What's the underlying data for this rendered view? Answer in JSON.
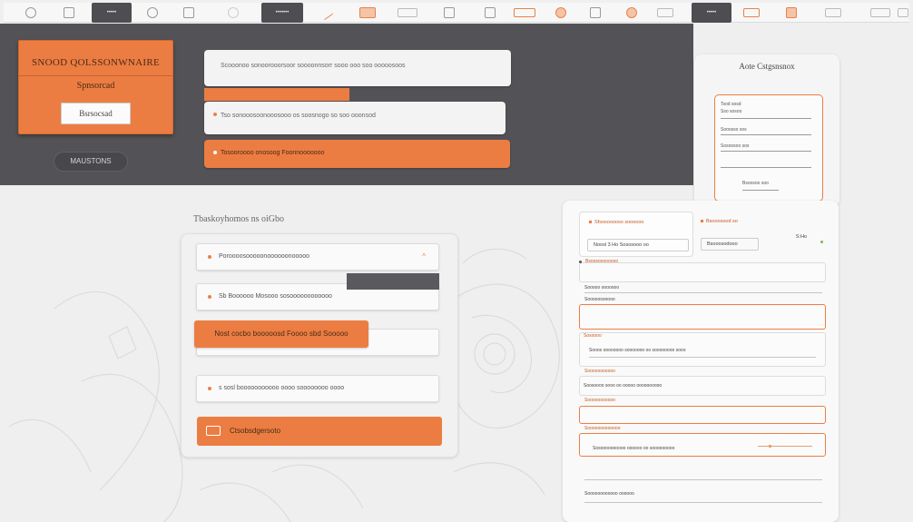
{
  "toolbar": {
    "tab_active_1": "•••••",
    "tab_active_2": "•••••••",
    "tab_active_3": "•••••"
  },
  "survey_card": {
    "title": "SNOOD QOLSSONWNAIRE",
    "subtitle": "Spnsorcad",
    "button_label": "Bsrsocsad"
  },
  "dark_pill": "MAUSTONS",
  "bars": [
    "Scooonoo sonoorooorsoor soooonnsorr sooo ooo soo ooooosoos",
    "Tso sonooosoonooosooo os soosnogo so soo ooonsod",
    "Tosooroooo onosoog Foonnooooooo"
  ],
  "section_heading": "Tbaskoyhomos ns oiGbo",
  "mid_rows": [
    "Poroooosooooonoooooonooooo",
    "Sb Boooooo Mosooo sosoooooooooooo",
    "Nost cocbo booooosd Foooo sbd Sooooo",
    "s sosl booooooooooo oooo soooooooo oooo",
    "Ctsobsdgersoto"
  ],
  "cg_card": {
    "title": "Aote Cstgsnsnox",
    "field_1": "Tsod sosd",
    "field_2": "Sso sosoo",
    "field_3": "Sooosso sos",
    "field_4": "Sosoosoo sos",
    "field_5": "Bsoosoo soo"
  },
  "results": {
    "stat_1_label": "Sfsosooooso soooooo",
    "stat_1_value": "Noosl 3 Ho Sososooo oo",
    "stat_2_label": "Bsooosood so",
    "stat_2_value": "Bsooosodooo",
    "stat_3_value": "S:Ho",
    "rows": [
      "Bsoosoooooooo",
      "Sooooo ooooooo",
      "Sooooosooooo",
      "Sooos oooooooo sooooooo oo soooooooo sooo",
      "Sosoooo",
      "Soosoooo sooo oo ooooo oooooooooo",
      "Sooooooooooo",
      "Sooooooooooo",
      "Sosoooooooooo oooooo oo sooooooooo",
      "Sooooooooooooo",
      "Soooooooooooo oooooo"
    ]
  }
}
